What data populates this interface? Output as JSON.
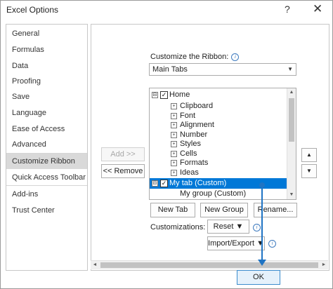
{
  "window": {
    "title": "Excel Options",
    "help_glyph": "?",
    "close_glyph": "✕"
  },
  "sidebar": {
    "items": [
      {
        "label": "General"
      },
      {
        "label": "Formulas"
      },
      {
        "label": "Data"
      },
      {
        "label": "Proofing"
      },
      {
        "label": "Save"
      },
      {
        "label": "Language"
      },
      {
        "label": "Ease of Access"
      },
      {
        "label": "Advanced"
      },
      {
        "label": "Customize Ribbon"
      },
      {
        "label": "Quick Access Toolbar"
      },
      {
        "label": "Add-ins"
      },
      {
        "label": "Trust Center"
      }
    ],
    "selected": "Customize Ribbon"
  },
  "customize": {
    "label": "Customize the Ribbon:",
    "info_glyph": "i",
    "dropdown_value": "Main Tabs",
    "dropdown_arrow": "▼"
  },
  "tree": {
    "home": {
      "expander": "⊟",
      "check": "✓",
      "label": "Home"
    },
    "home_groups": [
      {
        "expander": "+",
        "label": "Clipboard"
      },
      {
        "expander": "+",
        "label": "Font"
      },
      {
        "expander": "+",
        "label": "Alignment"
      },
      {
        "expander": "+",
        "label": "Number"
      },
      {
        "expander": "+",
        "label": "Styles"
      },
      {
        "expander": "+",
        "label": "Cells"
      },
      {
        "expander": "+",
        "label": "Formats"
      },
      {
        "expander": "+",
        "label": "Ideas"
      }
    ],
    "my_tab": {
      "expander": "⊟",
      "check": "✓",
      "label": "My tab (Custom)"
    },
    "my_group": {
      "label": "My group (Custom)"
    },
    "scroll_up": "▲",
    "scroll_down": "▼"
  },
  "buttons": {
    "add": "Add >>",
    "remove": "<< Remove",
    "move_up": "▲",
    "move_down": "▼",
    "new_tab": "New Tab",
    "new_group": "New Group",
    "rename": "Rename...",
    "reset": "Reset ▼",
    "import_export": "Import/Export ▼",
    "ok": "OK"
  },
  "customizations": {
    "label": "Customizations:",
    "info_glyph": "i"
  },
  "hscroll": {
    "left": "◄",
    "right": "►"
  },
  "colors": {
    "selection_blue": "#0078d7",
    "annotation_arrow": "#1f74c4",
    "ok_button_fill": "#e5f1fb"
  }
}
